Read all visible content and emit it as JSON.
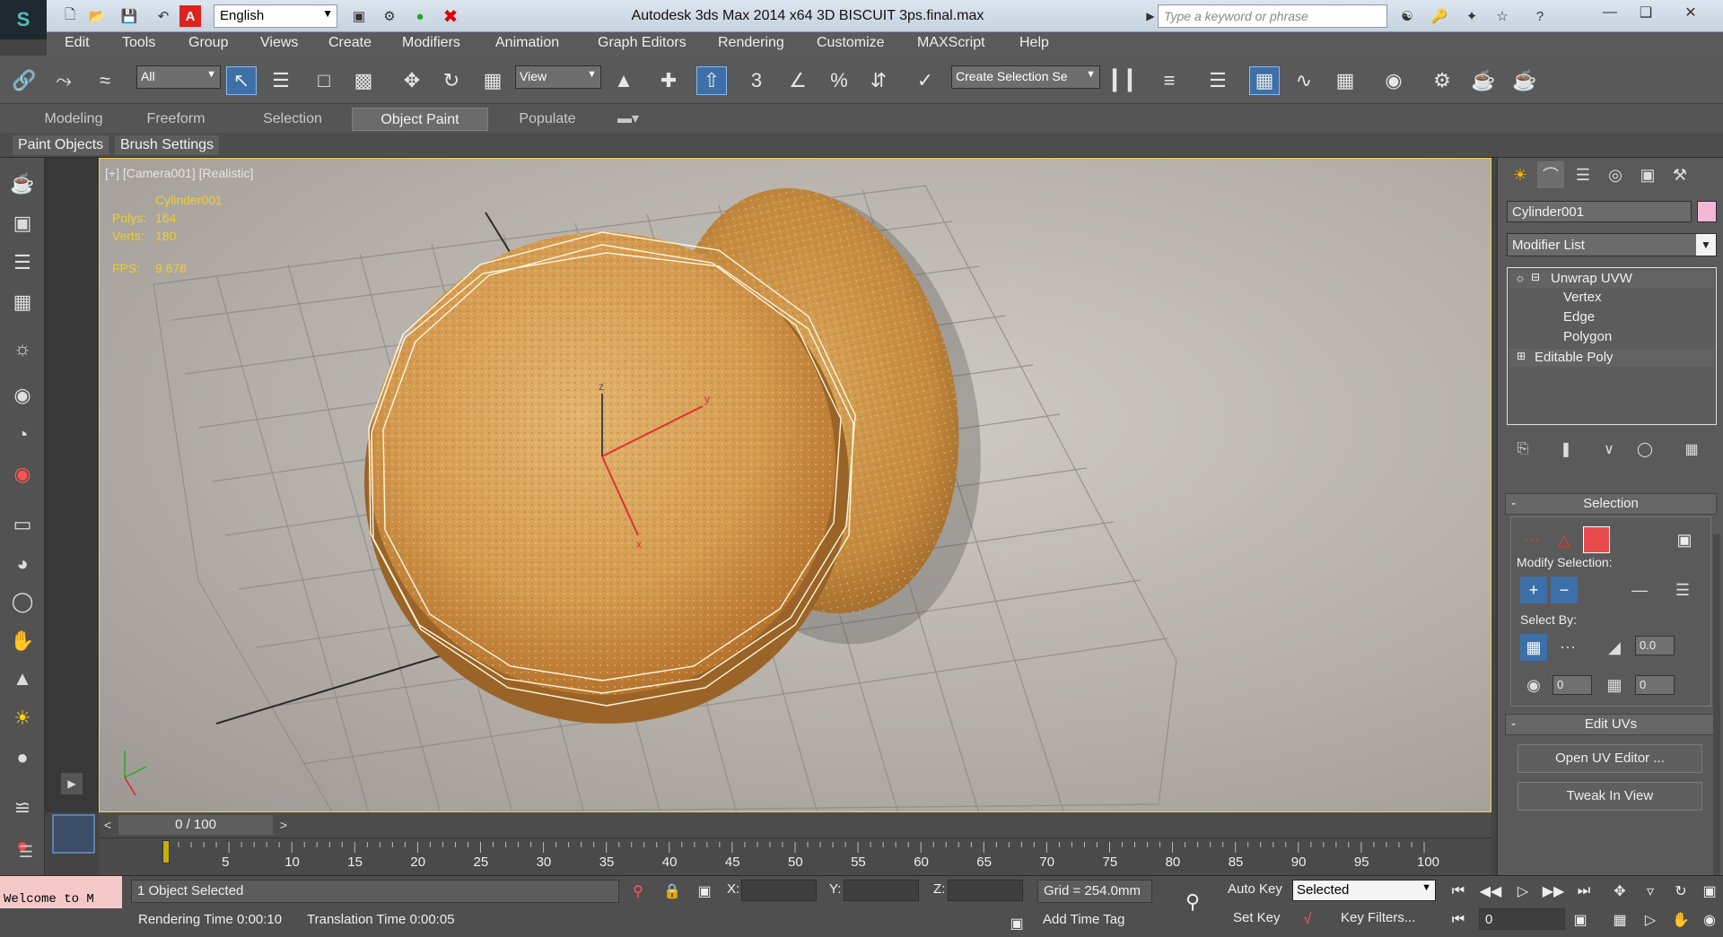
{
  "titlebar": {
    "language": "English",
    "title": "Autodesk 3ds Max  2014 x64     3D BISCUIT 3ps.final.max",
    "search_placeholder": "Type a keyword or phrase"
  },
  "menu": [
    "Edit",
    "Tools",
    "Group",
    "Views",
    "Create",
    "Modifiers",
    "Animation",
    "Graph Editors",
    "Rendering",
    "Customize",
    "MAXScript",
    "Help"
  ],
  "toolbar": {
    "selection_filter": "All",
    "ref_coord": "View",
    "named_selection": "Create Selection Se",
    "snap_labels": [
      "3",
      "%"
    ]
  },
  "ribbon": {
    "tabs": [
      "Modeling",
      "Freeform",
      "Selection",
      "Object Paint",
      "Populate"
    ],
    "active_tab": "Object Paint",
    "sub_tabs": [
      "Paint Objects",
      "Brush Settings"
    ]
  },
  "viewport": {
    "label": "[+] [Camera001] [Realistic]",
    "object_name": "Cylinder001",
    "polys_label": "Polys:",
    "polys_value": "164",
    "verts_label": "Verts:",
    "verts_value": "180",
    "fps_label": "FPS:",
    "fps_value": "9.676",
    "axis_labels": [
      "z",
      "y",
      "x"
    ]
  },
  "command_panel": {
    "object_name": "Cylinder001",
    "object_color": "#f4b6d6",
    "modifier_list": "Modifier List",
    "stack": [
      "Unwrap UVW",
      "Vertex",
      "Edge",
      "Polygon",
      "Editable Poly"
    ],
    "selection_title": "Selection",
    "modify_selection": "Modify Selection:",
    "select_by": "Select By:",
    "spinner_a": "0.0",
    "spinner_b": "0",
    "spinner_c": "0",
    "edit_uvs_title": "Edit UVs",
    "open_uv_editor": "Open UV Editor ...",
    "tweak_in_view": "Tweak In View"
  },
  "timeline": {
    "frame": "0 / 100",
    "ticks": [
      "5",
      "10",
      "15",
      "20",
      "25",
      "30",
      "35",
      "40",
      "45",
      "50",
      "55",
      "60",
      "65",
      "70",
      "75",
      "80",
      "85",
      "90",
      "95",
      "100"
    ]
  },
  "status": {
    "listener": "Welcome to M",
    "selected": "1 Object Selected",
    "render_time": "Rendering Time  0:00:10",
    "translation_time": "Translation Time  0:00:05",
    "x_label": "X:",
    "y_label": "Y:",
    "z_label": "Z:",
    "grid": "Grid = 254.0mm",
    "add_time_tag": "Add Time Tag",
    "auto_key": "Auto Key",
    "set_key": "Set Key",
    "key_mode": "Selected",
    "key_filters": "Key Filters...",
    "frame_field": "0"
  }
}
